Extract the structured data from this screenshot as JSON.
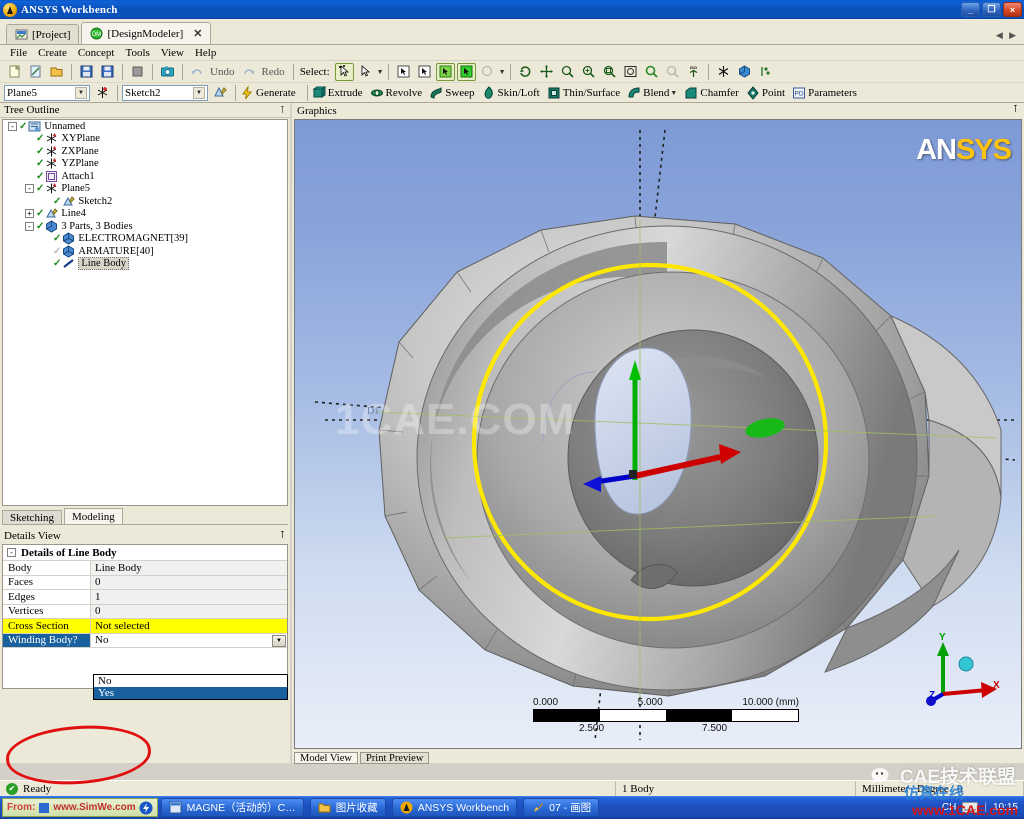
{
  "window": {
    "title": "ANSYS Workbench",
    "icon": "ansys-logo-icon",
    "minimize_label": "_",
    "maximize_label": "❐",
    "close_label": "×"
  },
  "workbench_tabs": {
    "items": [
      {
        "label": "[Project]",
        "icon": "project-icon",
        "active": false
      },
      {
        "label": "[DesignModeler]",
        "icon": "designmodeler-icon",
        "active": true,
        "close_label": "✕"
      }
    ],
    "scroll_arrows": "◀ ▶"
  },
  "menubar": {
    "items": [
      "File",
      "Create",
      "Concept",
      "Tools",
      "View",
      "Help"
    ]
  },
  "toolbar_main": {
    "file_buttons": [
      {
        "name": "new-icon",
        "label": "New"
      },
      {
        "name": "refresh-input-icon",
        "label": "Refresh Input"
      },
      {
        "name": "open-icon",
        "label": "Open"
      },
      {
        "name": "save-icon",
        "label": "Save"
      },
      {
        "name": "save-as-icon",
        "label": "Save As"
      },
      {
        "name": "export-icon",
        "label": "Export"
      },
      {
        "name": "screenshot-icon",
        "label": "Image Capture"
      }
    ],
    "undo_label": "Undo",
    "redo_label": "Redo",
    "select_label": "Select:",
    "select_modes": [
      {
        "name": "single-select-icon",
        "active": true
      },
      {
        "name": "box-select-icon",
        "active": false
      }
    ],
    "filter_buttons": [
      {
        "name": "select-vertices-icon",
        "active": false
      },
      {
        "name": "select-edges-icon",
        "active": false
      },
      {
        "name": "select-faces-icon",
        "active": true
      },
      {
        "name": "select-bodies-icon",
        "active": true
      }
    ],
    "extend_selection_label": "Extend Selection",
    "view_buttons": [
      {
        "name": "rotate-icon"
      },
      {
        "name": "pan-icon"
      },
      {
        "name": "zoom-icon"
      },
      {
        "name": "zoom-in-icon"
      },
      {
        "name": "box-zoom-icon"
      },
      {
        "name": "zoom-to-fit-icon"
      },
      {
        "name": "magnifier-icon"
      },
      {
        "name": "previous-view-icon"
      },
      {
        "name": "iso-view-icon"
      },
      {
        "name": "look-at-icon"
      },
      {
        "name": "display-plane-icon"
      },
      {
        "name": "display-model-icon"
      },
      {
        "name": "display-points-icon"
      }
    ]
  },
  "toolbar_feature": {
    "plane_selector": {
      "value": "Plane5",
      "arrow": "▼"
    },
    "new_plane_icon": "new-plane-icon",
    "sketch_selector": {
      "value": "Sketch2",
      "arrow": "▼"
    },
    "new_sketch_icon": "new-sketch-icon",
    "items": [
      {
        "label": "Generate",
        "icon": "generate-icon",
        "has_caret": false
      },
      {
        "label": "Extrude",
        "icon": "extrude-icon",
        "has_caret": false
      },
      {
        "label": "Revolve",
        "icon": "revolve-icon",
        "has_caret": false
      },
      {
        "label": "Sweep",
        "icon": "sweep-icon",
        "has_caret": false
      },
      {
        "label": "Skin/Loft",
        "icon": "skin-loft-icon",
        "has_caret": false
      },
      {
        "label": "Thin/Surface",
        "icon": "thin-surface-icon",
        "has_caret": false
      },
      {
        "label": "Blend",
        "icon": "blend-icon",
        "has_caret": true
      },
      {
        "label": "Chamfer",
        "icon": "chamfer-icon",
        "has_caret": false
      },
      {
        "label": "Point",
        "icon": "point-icon",
        "has_caret": false
      },
      {
        "label": "Parameters",
        "icon": "parameters-icon",
        "has_caret": false
      }
    ]
  },
  "tree_panel": {
    "title": "Tree Outline",
    "pin_icon": "pin-icon",
    "nodes": [
      {
        "label": "Unnamed",
        "depth": 0,
        "expander": "-",
        "check": "green",
        "icon": "model-icon",
        "selected": false
      },
      {
        "label": "XYPlane",
        "depth": 1,
        "expander": "",
        "check": "green",
        "icon": "plane-icon",
        "selected": false
      },
      {
        "label": "ZXPlane",
        "depth": 1,
        "expander": "",
        "check": "green",
        "icon": "plane-icon",
        "selected": false
      },
      {
        "label": "YZPlane",
        "depth": 1,
        "expander": "",
        "check": "green",
        "icon": "plane-icon",
        "selected": false
      },
      {
        "label": "Attach1",
        "depth": 1,
        "expander": "",
        "check": "green",
        "icon": "attach-icon",
        "selected": false
      },
      {
        "label": "Plane5",
        "depth": 1,
        "expander": "-",
        "check": "green",
        "icon": "plane-icon",
        "selected": false
      },
      {
        "label": "Sketch2",
        "depth": 2,
        "expander": "",
        "check": "green",
        "icon": "sketch-icon",
        "selected": false
      },
      {
        "label": "Line4",
        "depth": 1,
        "expander": "+",
        "check": "green",
        "icon": "sketch-icon",
        "selected": false
      },
      {
        "label": "3 Parts, 3 Bodies",
        "depth": 1,
        "expander": "-",
        "check": "green",
        "icon": "parts-icon",
        "selected": false
      },
      {
        "label": "ELECTROMAGNET[39]",
        "depth": 2,
        "expander": "",
        "check": "green",
        "icon": "solid-body-icon",
        "selected": false
      },
      {
        "label": "ARMATURE[40]",
        "depth": 2,
        "expander": "",
        "check": "gray",
        "icon": "solid-body-icon",
        "selected": false
      },
      {
        "label": "Line Body",
        "depth": 2,
        "expander": "",
        "check": "green",
        "icon": "line-body-icon",
        "selected": true
      }
    ]
  },
  "mode_tabs": {
    "items": [
      {
        "label": "Sketching",
        "active": false
      },
      {
        "label": "Modeling",
        "active": true
      }
    ]
  },
  "details_panel": {
    "title": "Details View",
    "pin_icon": "pin-icon",
    "section_expander": "-",
    "section_title": "Details of Line Body",
    "rows": [
      {
        "key": "Body",
        "value": "Line Body",
        "style": "normal"
      },
      {
        "key": "Faces",
        "value": "0",
        "style": "normal"
      },
      {
        "key": "Edges",
        "value": "1",
        "style": "normal"
      },
      {
        "key": "Vertices",
        "value": "0",
        "style": "normal"
      },
      {
        "key": "Cross Section",
        "value": "Not selected",
        "style": "yellow"
      },
      {
        "key": "Winding Body?",
        "value": "No",
        "style": "active",
        "arrow": "▼"
      }
    ],
    "dropdown": {
      "open": true,
      "options": [
        {
          "label": "No",
          "selected": false
        },
        {
          "label": "Yes",
          "selected": true
        }
      ]
    },
    "annotation": "red-ellipse-highlight"
  },
  "graphics_panel": {
    "title": "Graphics",
    "pin_icon": "pin-icon",
    "brand": {
      "part1": "AN",
      "part2": "SYS"
    },
    "watermark": "1CAE.COM",
    "dim_label": "D1",
    "scale_bar": {
      "top_labels": [
        "0.000",
        "5.000",
        "10.000 (mm)"
      ],
      "bottom_labels": [
        "2.500",
        "7.500"
      ],
      "segments": 4
    },
    "triad": {
      "x_label": "X",
      "y_label": "Y",
      "z_label": "Z",
      "x_color": "#cc0000",
      "y_color": "#00a000",
      "z_color": "#0000cc",
      "iso_ball_color": "#35c6d6"
    },
    "view_tabs": [
      {
        "label": "Model View",
        "active": true
      },
      {
        "label": "Print Preview",
        "active": false
      }
    ]
  },
  "statusbar": {
    "ready_icon": "ready-check-icon",
    "ready_text": "Ready",
    "selection_text": "1 Body",
    "unit_text": "Millimeter",
    "degree_text": "Degree",
    "zero_text": "0"
  },
  "taskbar": {
    "simwe": {
      "prefix": "From:",
      "text": "www.SimWe.com"
    },
    "items": [
      {
        "label": "MAGNE（活动的）C…",
        "icon": "window-icon",
        "active": false
      },
      {
        "label": "图片收藏",
        "icon": "folder-icon",
        "active": false
      },
      {
        "label": "ANSYS Workbench",
        "icon": "ansys-icon",
        "active": false
      },
      {
        "label": "07 - 画图",
        "icon": "paint-icon",
        "active": true
      }
    ],
    "tray": {
      "ime": "CH",
      "keyboard_icon": "keyboard-icon",
      "clock": "10:15"
    }
  },
  "overlay_watermark": {
    "wechat_icon": "wechat-icon",
    "cae_text": "CAE技术联盟",
    "blue_text": "仿真在线",
    "red_text": "www.1CAE.com"
  },
  "colors": {
    "titlebar_blue": "#0a52bd",
    "panel_bg": "#ece9d8",
    "accent_yellow": "#ffff00",
    "selection_blue": "#19619e",
    "annotation_red": "#e01010",
    "ansys_gold": "#ffc20e",
    "viewport_top": "#7e9ad6",
    "viewport_bottom": "#e9eef8"
  }
}
